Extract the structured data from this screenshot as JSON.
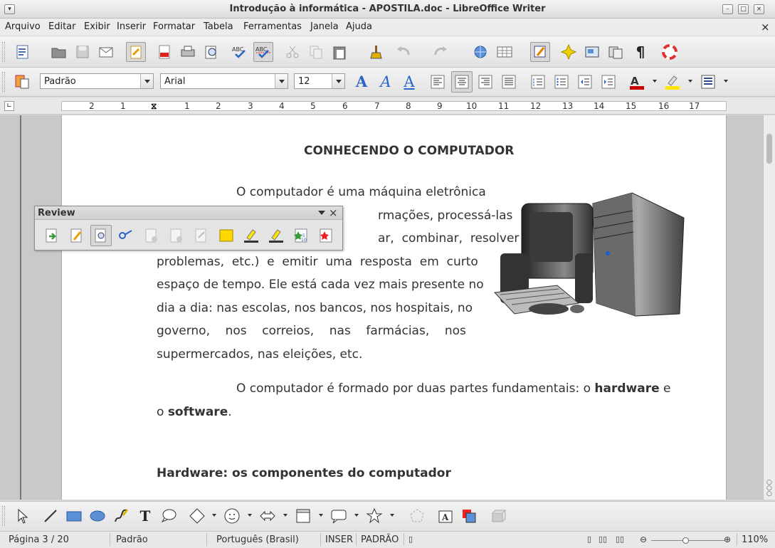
{
  "window": {
    "title": "Introdução à informática - APOSTILA.doc - LibreOffice Writer"
  },
  "menu": [
    "Arquivo",
    "Editar",
    "Exibir",
    "Inserir",
    "Formatar",
    "Tabela",
    "Ferramentas",
    "Janela",
    "Ajuda"
  ],
  "format": {
    "style": "Padrão",
    "font": "Arial",
    "size": "12"
  },
  "ruler": {
    "labels": [
      "2",
      "1",
      "1",
      "2",
      "3",
      "4",
      "5",
      "6",
      "7",
      "8",
      "9",
      "10",
      "11",
      "12",
      "13",
      "14",
      "15",
      "16",
      "17"
    ]
  },
  "review": {
    "title": "Review"
  },
  "document": {
    "heading": "CONHECENDO O COMPUTADOR",
    "para1_lines": [
      "O computador é uma máquina eletrônica",
      "rmações, processá-las",
      "ar,  combinar,  resolver",
      "problemas,  etc.)  e  emitir  uma  resposta  em  curto",
      "espaço de tempo. Ele está cada vez mais presente no",
      "dia a dia: nas escolas, nos bancos, nos hospitais, no",
      "governo,    nos    correios,    nas    farmácias,    nos",
      "supermercados, nas eleições, etc."
    ],
    "para2_prefix": "O computador é formado por duas partes fundamentais: o ",
    "para2_bold1": "hardware",
    "para2_mid": " e",
    "para2_line2_prefix": "o ",
    "para2_bold2": "software",
    "para2_end": ".",
    "section_heading": "Hardware: os componentes do computador"
  },
  "status": {
    "page": "Página 3 / 20",
    "style": "Padrão",
    "language": "Português (Brasil)",
    "insert_mode": "INSER",
    "selection_mode": "PADRÃO",
    "zoom": "110%"
  }
}
